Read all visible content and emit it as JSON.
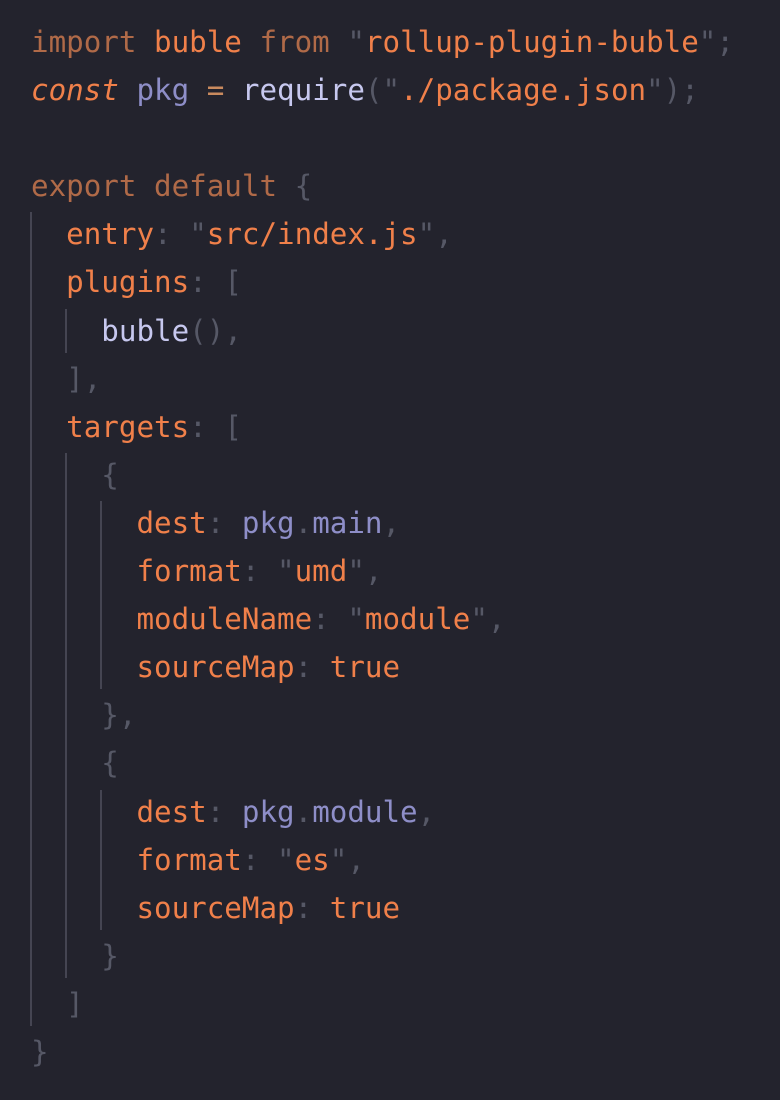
{
  "editor": {
    "language": "javascript",
    "lines": [
      [
        {
          "t": "import",
          "c": "kw"
        },
        {
          "t": " "
        },
        {
          "t": "buble",
          "c": "id"
        },
        {
          "t": " "
        },
        {
          "t": "from",
          "c": "kw"
        },
        {
          "t": " "
        },
        {
          "t": "\"",
          "c": "punc"
        },
        {
          "t": "rollup-plugin-buble",
          "c": "str"
        },
        {
          "t": "\"",
          "c": "punc"
        },
        {
          "t": ";",
          "c": "punc"
        }
      ],
      [
        {
          "t": "const",
          "c": "kwi"
        },
        {
          "t": " "
        },
        {
          "t": "pkg",
          "c": "var"
        },
        {
          "t": " "
        },
        {
          "t": "=",
          "c": "op"
        },
        {
          "t": " "
        },
        {
          "t": "require",
          "c": "fn"
        },
        {
          "t": "(",
          "c": "punc"
        },
        {
          "t": "\"",
          "c": "punc"
        },
        {
          "t": "./package.json",
          "c": "str"
        },
        {
          "t": "\"",
          "c": "punc"
        },
        {
          "t": ");",
          "c": "punc"
        }
      ],
      [],
      [
        {
          "t": "export",
          "c": "kw"
        },
        {
          "t": " "
        },
        {
          "t": "default",
          "c": "kw"
        },
        {
          "t": " "
        },
        {
          "t": "{",
          "c": "punc"
        }
      ],
      [
        {
          "t": "  "
        },
        {
          "t": "entry",
          "c": "id"
        },
        {
          "t": ":",
          "c": "punc"
        },
        {
          "t": " "
        },
        {
          "t": "\"",
          "c": "punc"
        },
        {
          "t": "src/index.js",
          "c": "str"
        },
        {
          "t": "\"",
          "c": "punc"
        },
        {
          "t": ",",
          "c": "punc"
        }
      ],
      [
        {
          "t": "  "
        },
        {
          "t": "plugins",
          "c": "id"
        },
        {
          "t": ":",
          "c": "punc"
        },
        {
          "t": " "
        },
        {
          "t": "[",
          "c": "punc"
        }
      ],
      [
        {
          "t": "    "
        },
        {
          "t": "buble",
          "c": "fn"
        },
        {
          "t": "()",
          "c": "punc"
        },
        {
          "t": ",",
          "c": "punc"
        }
      ],
      [
        {
          "t": "  "
        },
        {
          "t": "],",
          "c": "punc"
        }
      ],
      [
        {
          "t": "  "
        },
        {
          "t": "targets",
          "c": "id"
        },
        {
          "t": ":",
          "c": "punc"
        },
        {
          "t": " "
        },
        {
          "t": "[",
          "c": "punc"
        }
      ],
      [
        {
          "t": "    "
        },
        {
          "t": "{",
          "c": "punc"
        }
      ],
      [
        {
          "t": "      "
        },
        {
          "t": "dest",
          "c": "id"
        },
        {
          "t": ":",
          "c": "punc"
        },
        {
          "t": " "
        },
        {
          "t": "pkg",
          "c": "var"
        },
        {
          "t": ".",
          "c": "punc"
        },
        {
          "t": "main",
          "c": "var"
        },
        {
          "t": ",",
          "c": "punc"
        }
      ],
      [
        {
          "t": "      "
        },
        {
          "t": "format",
          "c": "id"
        },
        {
          "t": ":",
          "c": "punc"
        },
        {
          "t": " "
        },
        {
          "t": "\"",
          "c": "punc"
        },
        {
          "t": "umd",
          "c": "str"
        },
        {
          "t": "\"",
          "c": "punc"
        },
        {
          "t": ",",
          "c": "punc"
        }
      ],
      [
        {
          "t": "      "
        },
        {
          "t": "moduleName",
          "c": "id"
        },
        {
          "t": ":",
          "c": "punc"
        },
        {
          "t": " "
        },
        {
          "t": "\"",
          "c": "punc"
        },
        {
          "t": "module",
          "c": "str"
        },
        {
          "t": "\"",
          "c": "punc"
        },
        {
          "t": ",",
          "c": "punc"
        }
      ],
      [
        {
          "t": "      "
        },
        {
          "t": "sourceMap",
          "c": "id"
        },
        {
          "t": ":",
          "c": "punc"
        },
        {
          "t": " "
        },
        {
          "t": "true",
          "c": "id"
        }
      ],
      [
        {
          "t": "    "
        },
        {
          "t": "},",
          "c": "punc"
        }
      ],
      [
        {
          "t": "    "
        },
        {
          "t": "{",
          "c": "punc"
        }
      ],
      [
        {
          "t": "      "
        },
        {
          "t": "dest",
          "c": "id"
        },
        {
          "t": ":",
          "c": "punc"
        },
        {
          "t": " "
        },
        {
          "t": "pkg",
          "c": "var"
        },
        {
          "t": ".",
          "c": "punc"
        },
        {
          "t": "module",
          "c": "var"
        },
        {
          "t": ",",
          "c": "punc"
        }
      ],
      [
        {
          "t": "      "
        },
        {
          "t": "format",
          "c": "id"
        },
        {
          "t": ":",
          "c": "punc"
        },
        {
          "t": " "
        },
        {
          "t": "\"",
          "c": "punc"
        },
        {
          "t": "es",
          "c": "str"
        },
        {
          "t": "\"",
          "c": "punc"
        },
        {
          "t": ",",
          "c": "punc"
        }
      ],
      [
        {
          "t": "      "
        },
        {
          "t": "sourceMap",
          "c": "id"
        },
        {
          "t": ":",
          "c": "punc"
        },
        {
          "t": " "
        },
        {
          "t": "true",
          "c": "id"
        }
      ],
      [
        {
          "t": "    "
        },
        {
          "t": "}",
          "c": "punc"
        }
      ],
      [
        {
          "t": "  "
        },
        {
          "t": "]",
          "c": "punc"
        }
      ],
      [
        {
          "t": "}",
          "c": "punc"
        }
      ]
    ],
    "indent_guides": [
      {
        "level": 0,
        "from_line": 4,
        "to_line": 20
      },
      {
        "level": 1,
        "from_line": 6,
        "to_line": 6
      },
      {
        "level": 1,
        "from_line": 9,
        "to_line": 19
      },
      {
        "level": 2,
        "from_line": 10,
        "to_line": 13
      },
      {
        "level": 2,
        "from_line": 16,
        "to_line": 18
      }
    ]
  }
}
